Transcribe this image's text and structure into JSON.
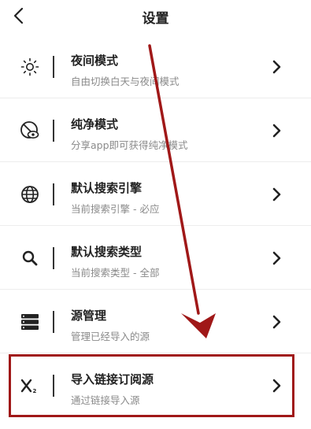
{
  "header": {
    "title": "设置"
  },
  "items": [
    {
      "icon": "sun-icon",
      "name": "夜间模式",
      "desc": "自由切换白天与夜间模式"
    },
    {
      "icon": "eye-slash-icon",
      "name": "纯净模式",
      "desc": "分享app即可获得纯净模式"
    },
    {
      "icon": "globe-icon",
      "name": "默认搜索引擎",
      "desc": "当前搜索引擎 - 必应"
    },
    {
      "icon": "search-icon",
      "name": "默认搜索类型",
      "desc": "当前搜索类型 - 全部"
    },
    {
      "icon": "server-icon",
      "name": "源管理",
      "desc": "管理已经导入的源"
    },
    {
      "icon": "subscript-icon",
      "name": "导入链接订阅源",
      "desc": "通过链接导入源"
    }
  ],
  "annotation": {
    "color": "#a01818"
  }
}
